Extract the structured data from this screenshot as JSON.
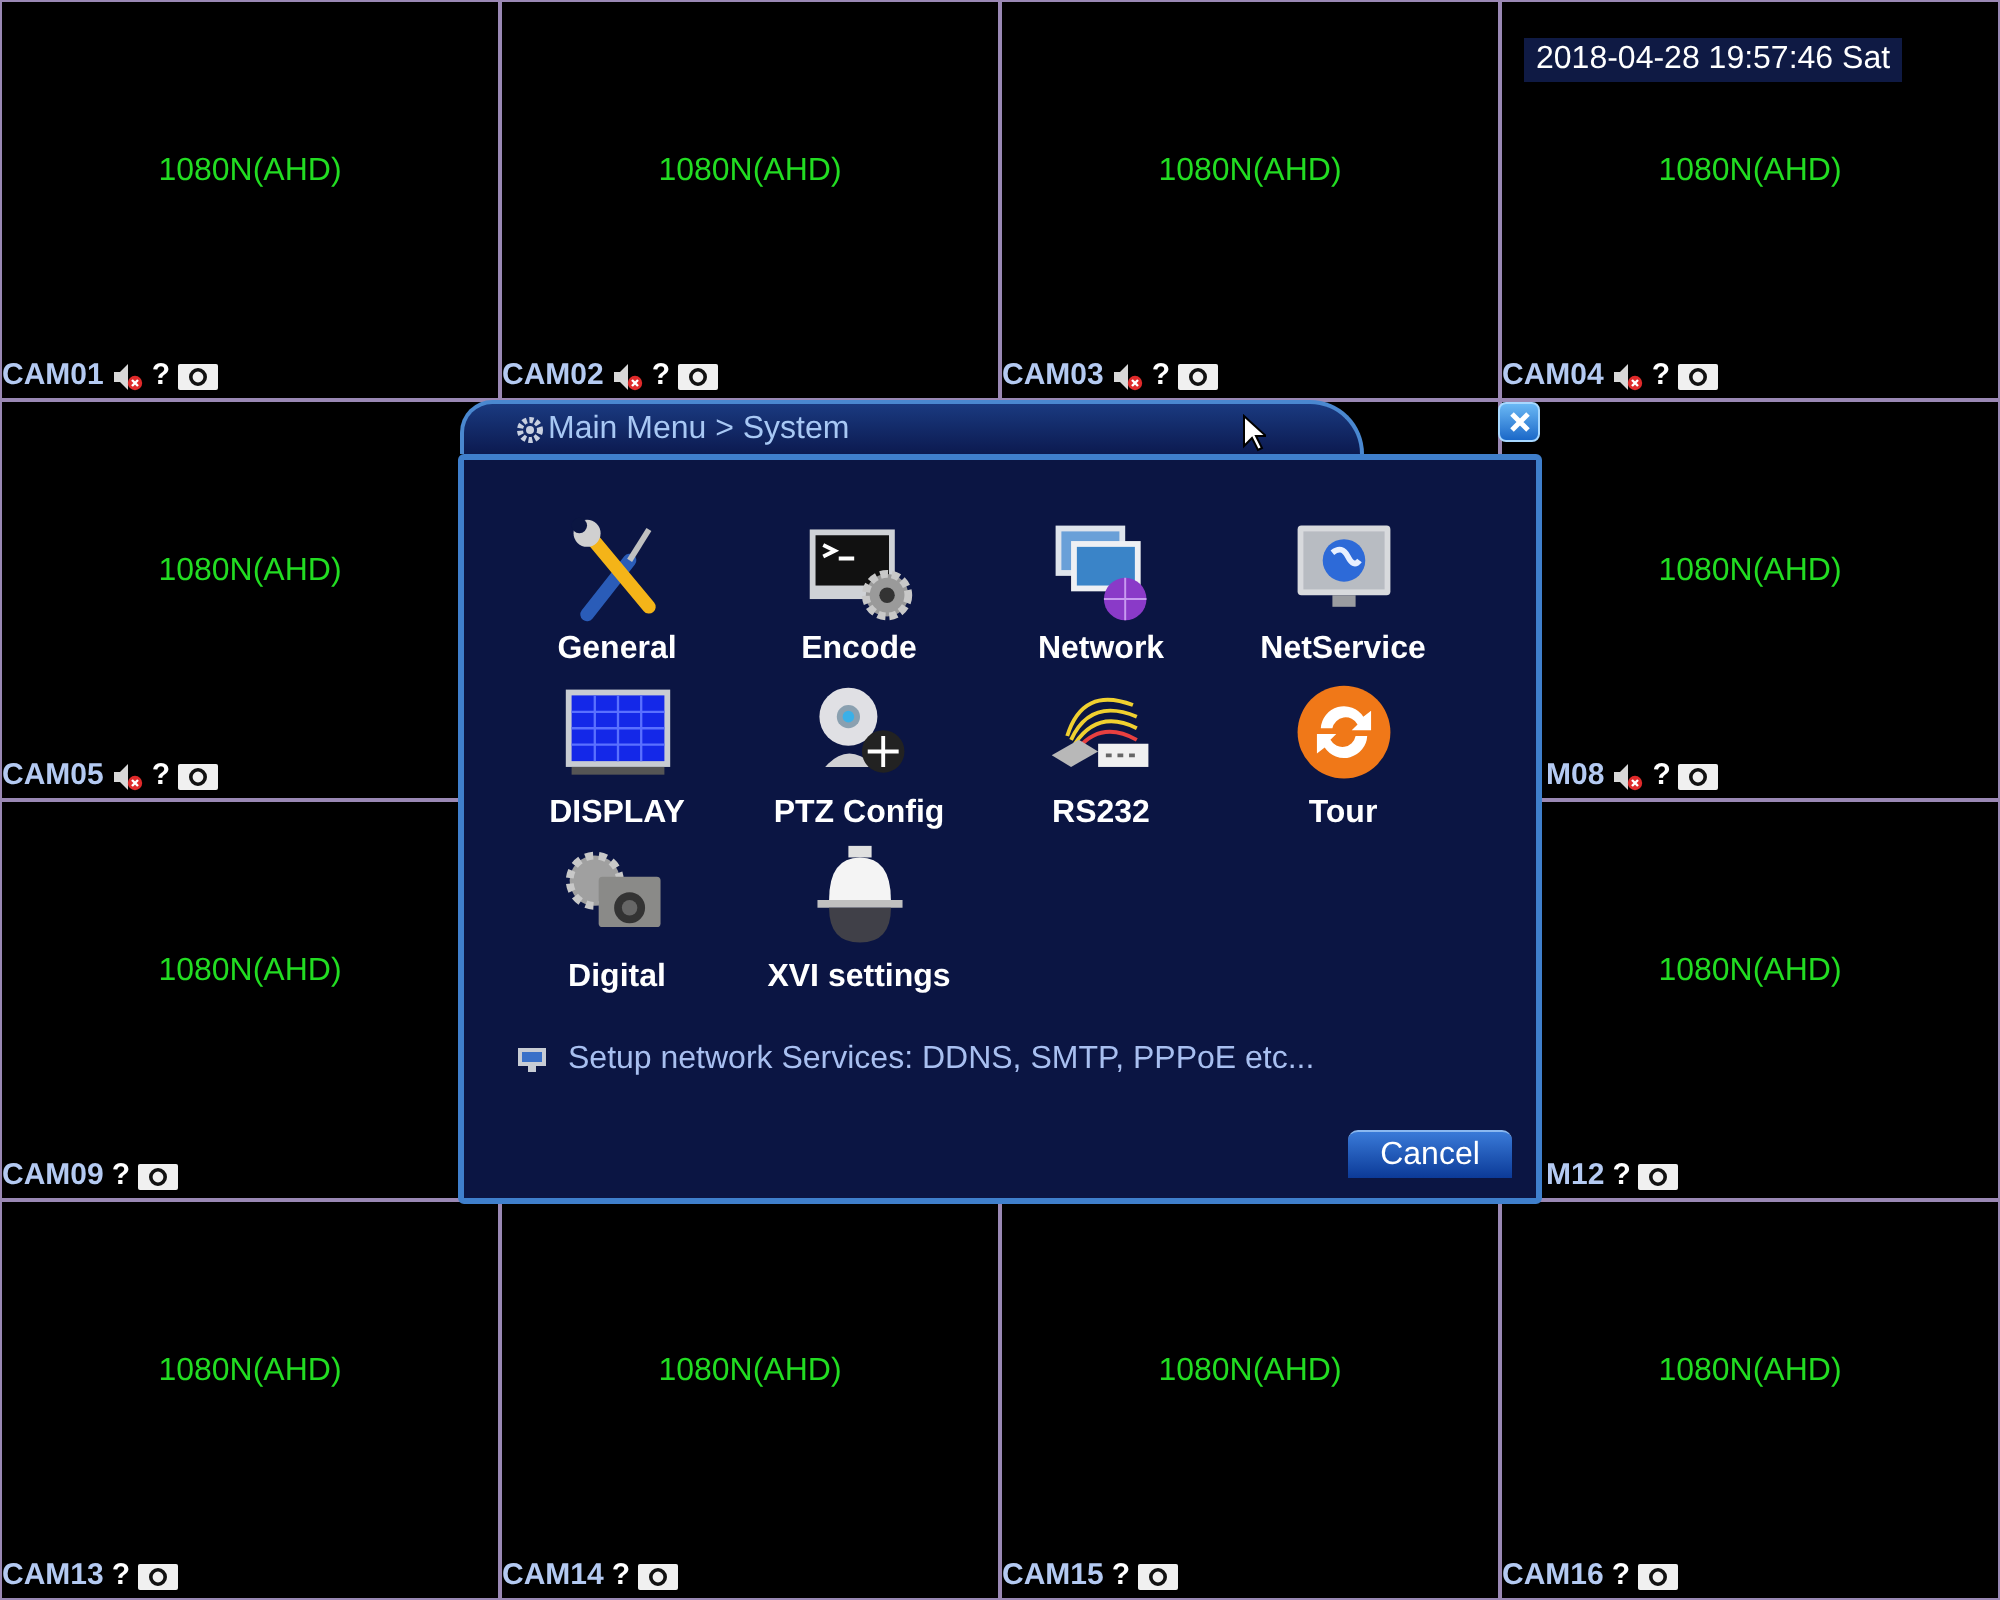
{
  "timestamp": "2018-04-28 19:57:46 Sat",
  "grid_rows": [
    {
      "cells": [
        {
          "video": "1080N(AHD)",
          "label": "CAM01",
          "audio_muted": true,
          "status_mark": "?"
        },
        {
          "video": "1080N(AHD)",
          "label": "CAM02",
          "audio_muted": true,
          "status_mark": "?"
        },
        {
          "video": "1080N(AHD)",
          "label": "CAM03",
          "audio_muted": true,
          "status_mark": "?"
        },
        {
          "video": "1080N(AHD)",
          "label": "CAM04",
          "audio_muted": true,
          "status_mark": "?"
        }
      ]
    },
    {
      "cells": [
        {
          "video": "1080N(AHD)",
          "label": "CAM05",
          "audio_muted": true,
          "status_mark": "?"
        },
        {
          "video": "1080N(AHD)",
          "label": "M08",
          "audio_muted": true,
          "status_mark": "?"
        }
      ]
    },
    {
      "cells": [
        {
          "video": "1080N(AHD)",
          "label": "CAM09",
          "audio_muted": false,
          "status_mark": "?"
        },
        {
          "video": "1080N(AHD)",
          "label": "M12",
          "audio_muted": false,
          "status_mark": "?"
        }
      ]
    },
    {
      "cells": [
        {
          "video": "1080N(AHD)",
          "label": "CAM13",
          "audio_muted": false,
          "status_mark": "?"
        },
        {
          "video": "1080N(AHD)",
          "label": "CAM14",
          "audio_muted": false,
          "status_mark": "?"
        },
        {
          "video": "1080N(AHD)",
          "label": "CAM15",
          "audio_muted": false,
          "status_mark": "?"
        },
        {
          "video": "1080N(AHD)",
          "label": "CAM16",
          "audio_muted": false,
          "status_mark": "?"
        }
      ]
    }
  ],
  "dialog": {
    "title": "Main Menu > System",
    "items": [
      {
        "label": "General"
      },
      {
        "label": "Encode"
      },
      {
        "label": "Network"
      },
      {
        "label": "NetService"
      },
      {
        "label": "DISPLAY"
      },
      {
        "label": "PTZ Config"
      },
      {
        "label": "RS232"
      },
      {
        "label": "Tour"
      },
      {
        "label": "Digital"
      },
      {
        "label": "XVI settings"
      }
    ],
    "hint": "Setup network Services: DDNS, SMTP, PPPoE etc...",
    "buttons": [
      "Cancel"
    ]
  }
}
